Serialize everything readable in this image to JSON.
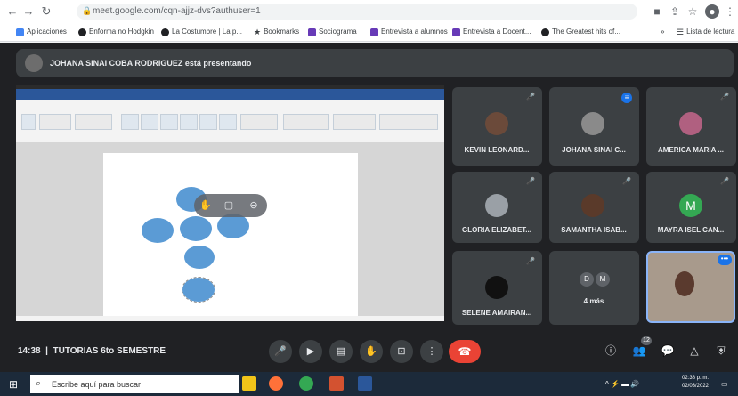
{
  "browser": {
    "url": "meet.google.com/cqn-ajjz-dvs?authuser=1",
    "bookmarks": [
      {
        "label": "Aplicaciones",
        "color": "#4285f4"
      },
      {
        "label": "Enforma no Hodgkin",
        "color": "#202124"
      },
      {
        "label": "La Costumbre | La p...",
        "color": "#202124"
      },
      {
        "label": "Bookmarks",
        "color": "#202124"
      },
      {
        "label": "Sociograma",
        "color": "#673ab7"
      },
      {
        "label": "Entrevista a alumnos",
        "color": "#673ab7"
      },
      {
        "label": "Entrevista a Docent...",
        "color": "#673ab7"
      },
      {
        "label": "The Greatest hits of...",
        "color": "#202124"
      }
    ],
    "reading_list": "Lista de lectura"
  },
  "meet": {
    "presenting_banner": "JOHANA SINAI COBA RODRIGUEZ está presentando",
    "participants": [
      {
        "name": "KEVIN LEONARD...",
        "avatar_color": "#6b4a3a"
      },
      {
        "name": "JOHANA SINAI C...",
        "avatar_color": "#8a8a8a"
      },
      {
        "name": "AMERICA MARIA ...",
        "avatar_color": "#b06080"
      },
      {
        "name": "GLORIA ELIZABET...",
        "avatar_color": "#9aa0a6"
      },
      {
        "name": "SAMANTHA ISAB...",
        "avatar_color": "#5a3a2a"
      },
      {
        "name": "MAYRA ISEL CAN...",
        "avatar_color": "#34a853",
        "initial": "M"
      },
      {
        "name": "SELENE AMAIRAN...",
        "avatar_color": "#111111"
      }
    ],
    "more": {
      "label": "4 más",
      "initials": [
        "D",
        "M"
      ]
    },
    "meeting_time": "14:38",
    "meeting_name": "TUTORIAS 6to SEMESTRE",
    "participant_count": "12"
  },
  "taskbar": {
    "search_placeholder": "Escribe aquí para buscar",
    "time": "02:38 p. m.",
    "date": "02/03/2022"
  },
  "colors": {
    "accent": "#1a73e8",
    "hangup": "#ea4335",
    "ellipse": "#5b9bd5"
  }
}
